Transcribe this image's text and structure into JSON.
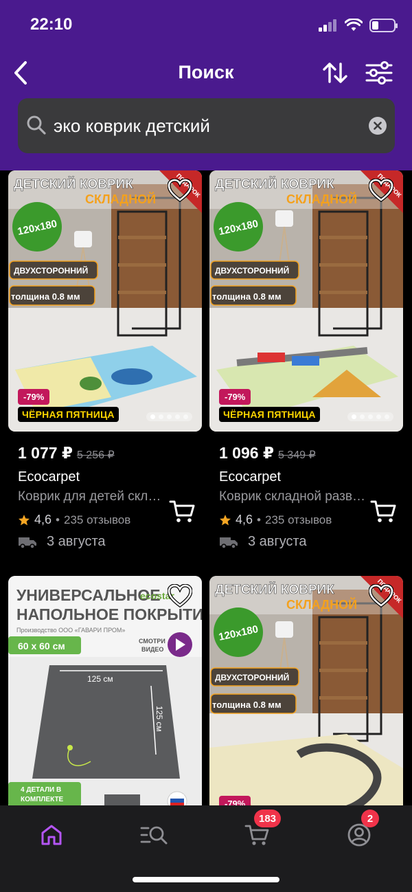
{
  "status": {
    "time": "22:10"
  },
  "header": {
    "title": "Поиск"
  },
  "search": {
    "value": "эко коврик детский",
    "placeholder": ""
  },
  "colors": {
    "header_bg": "#4a1a8e",
    "accent_purple": "#b455f5",
    "badge_red": "#f0334a",
    "discount": "#c2185b",
    "star": "#f5a623",
    "black_friday_text": "#ffd600"
  },
  "products": [
    {
      "banner_line1": "ДЕТСКИЙ КОВРИК",
      "banner_line2": "СКЛАДНОЙ",
      "size_badge": "120x180",
      "feature1": "ДВУХСТОРОННИЙ",
      "feature2": "толщина 0.8 мм",
      "corner_text": "ПОДАРОК",
      "discount": "-79%",
      "promo": "ЧЁРНАЯ ПЯТНИЦА",
      "price": "1 077 ₽",
      "old_price": "5 256 ₽",
      "brand": "Ecocarpet",
      "title": "Коврик для детей складной",
      "rating": "4,6",
      "reviews": "235 отзывов",
      "delivery": "3 августа"
    },
    {
      "banner_line1": "ДЕТСКИЙ КОВРИК",
      "banner_line2": "СКЛАДНОЙ",
      "size_badge": "120x180",
      "feature1": "ДВУХСТОРОННИЙ",
      "feature2": "толщина 0.8 мм",
      "corner_text": "ПОДАРОК",
      "discount": "-79%",
      "promo": "ЧЁРНАЯ ПЯТНИЦА",
      "price": "1 096 ₽",
      "old_price": "5 349 ₽",
      "brand": "Ecocarpet",
      "title": "Коврик складной развивающий",
      "rating": "4,6",
      "reviews": "235 отзывов",
      "delivery": "3 августа"
    },
    {
      "banner_line1": "УНИВЕРСАЛЬНОЕ",
      "banner_line2": "НАПОЛЬНОЕ ПОКРЫТИЕ",
      "brand_logo": "ecostar",
      "producer": "Производство ООО «ГАВАРИ ПРОМ»",
      "size_badge": "60 х 60 см",
      "video_label_1": "СМОТРИ",
      "video_label_2": "ВИДЕО",
      "dim_width": "125 см",
      "dim_height": "125 см",
      "parts_line1": "4 ДЕТАЛИ В",
      "parts_line2": "КОМПЛЕКТЕ"
    },
    {
      "banner_line1": "ДЕТСКИЙ КОВРИК",
      "banner_line2": "СКЛАДНОЙ",
      "size_badge": "120x180",
      "feature1": "ДВУХСТОРОННИЙ",
      "feature2": "толщина 0.8 мм",
      "corner_text": "ПОДАРОК",
      "discount": "-79%"
    }
  ],
  "tabbar": {
    "tabs": [
      {
        "name": "home",
        "icon": "home-icon",
        "active": true
      },
      {
        "name": "catalog",
        "icon": "catalog-search-icon"
      },
      {
        "name": "cart",
        "icon": "cart-icon",
        "badge": "183"
      },
      {
        "name": "profile",
        "icon": "profile-icon",
        "badge": "2"
      }
    ]
  }
}
